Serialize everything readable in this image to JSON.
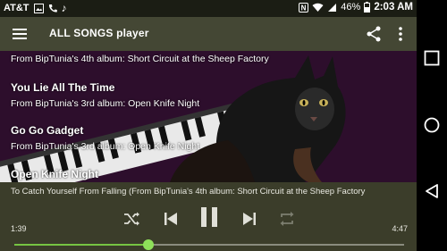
{
  "status_bar": {
    "carrier": "AT&T",
    "battery": "46%",
    "time": "2:03 AM"
  },
  "app_bar": {
    "title": "ALL SONGS player",
    "icons": [
      "menu-icon",
      "share-icon",
      "more-vert-icon"
    ]
  },
  "song_list": [
    {
      "title": "",
      "subtitle": "From BipTunia's 4th album: Short Circuit at the Sheep Factory"
    },
    {
      "title": "You Lie All The Time",
      "subtitle": "From BipTunia's 3rd album: Open Knife Night"
    },
    {
      "title": "Go Go Gadget",
      "subtitle": "From BipTunia's 3rd album: Open Knife Night"
    },
    {
      "title": "Open Knife Night",
      "subtitle": ""
    }
  ],
  "player": {
    "now_playing": "To Catch Yourself From Falling (From BipTunia's 4th album: Short Circuit at the Sheep Factory",
    "elapsed": "1:39",
    "duration": "4:47",
    "progress": 0.345
  },
  "colors": {
    "app_bar": "#444734",
    "controls": "#3b3d2a",
    "accent": "#76c442",
    "list_bg": "#2b0f2a"
  }
}
